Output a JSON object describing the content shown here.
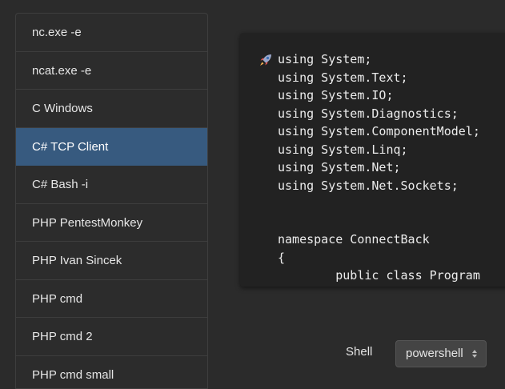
{
  "sidebar": {
    "items": [
      {
        "label": "nc.exe -e"
      },
      {
        "label": "ncat.exe -e"
      },
      {
        "label": "C Windows"
      },
      {
        "label": "C# TCP Client"
      },
      {
        "label": "C# Bash -i"
      },
      {
        "label": "PHP PentestMonkey"
      },
      {
        "label": "PHP Ivan Sincek"
      },
      {
        "label": "PHP cmd"
      },
      {
        "label": "PHP cmd 2"
      },
      {
        "label": "PHP cmd small"
      }
    ],
    "active_index": 3
  },
  "code_panel": {
    "icon": "rocket-icon",
    "text": "using System;\nusing System.Text;\nusing System.IO;\nusing System.Diagnostics;\nusing System.ComponentModel;\nusing System.Linq;\nusing System.Net;\nusing System.Net.Sockets;\n\n\nnamespace ConnectBack\n{\n        public class Program"
  },
  "shell": {
    "label": "Shell",
    "selected": "powershell"
  },
  "colors": {
    "background": "#2b2b2b",
    "active_item": "#375a7f",
    "code_background": "#222222"
  }
}
